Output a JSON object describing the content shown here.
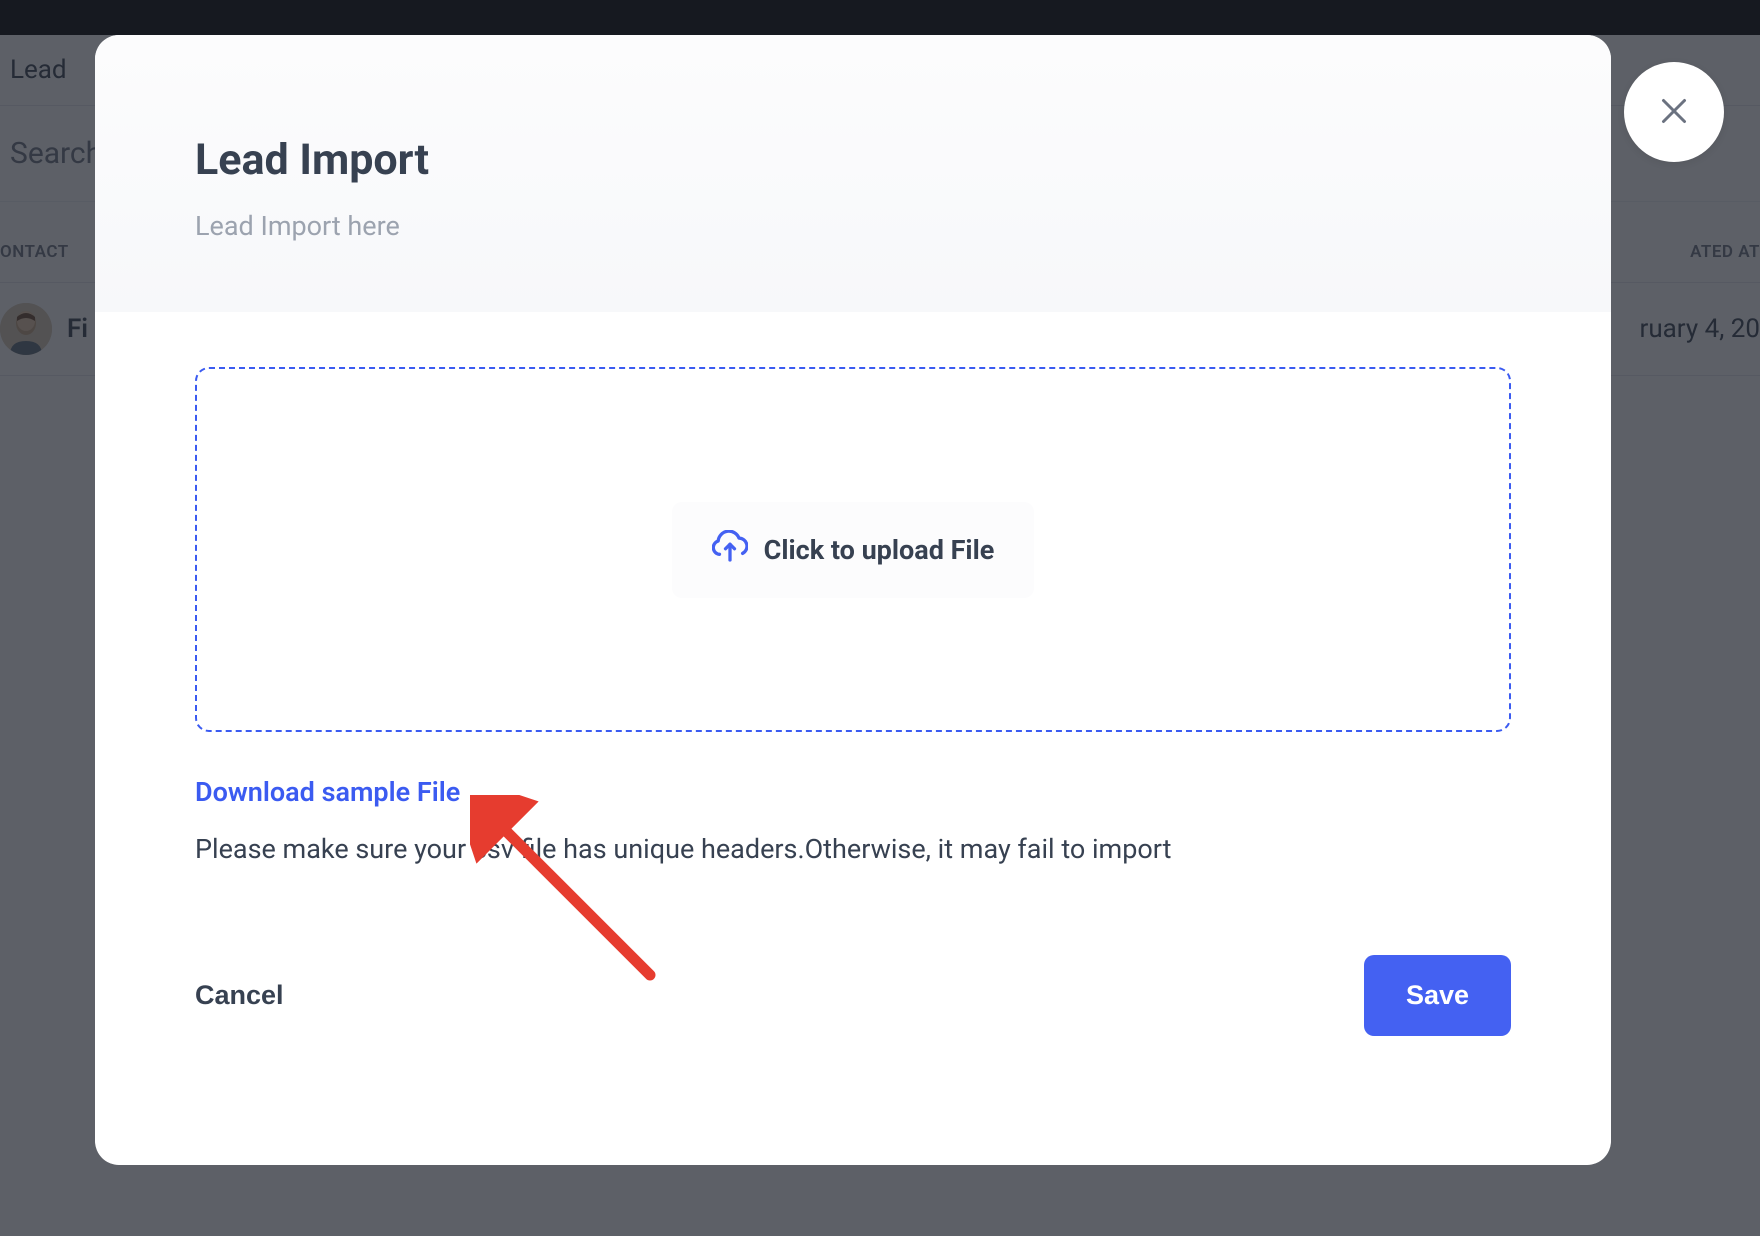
{
  "background": {
    "lead_label": "Lead",
    "search_placeholder": "Search",
    "columns": {
      "contact": "ONTACT",
      "created_at": "ATED AT"
    },
    "row": {
      "name_fragment": "Fi",
      "date_fragment": "ruary 4, 20"
    }
  },
  "modal": {
    "title": "Lead Import",
    "subtitle": "Lead Import here",
    "upload_label": "Click to upload File",
    "download_link": "Download sample File",
    "help_text": "Please make sure your csv file has unique headers.Otherwise, it may fail to import",
    "cancel_label": "Cancel",
    "save_label": "Save"
  }
}
